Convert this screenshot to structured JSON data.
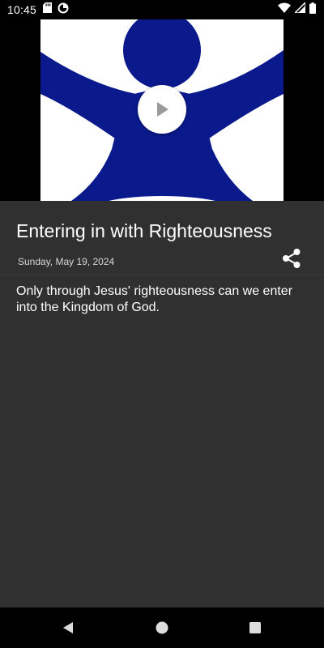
{
  "status_bar": {
    "time": "10:45",
    "left_icons": [
      "sd-card-icon",
      "data-saver-icon"
    ],
    "right_icons": [
      "wifi-icon",
      "signal-icon",
      "battery-icon"
    ]
  },
  "video": {
    "thumbnail_icon": "person-arms-raised-logo",
    "play_icon": "play-icon",
    "brand_color": "#0a1a8c"
  },
  "content": {
    "title": "Entering in with Righteousness",
    "date": "Sunday, May 19, 2024",
    "share_icon": "share-icon",
    "description": "Only through Jesus' righteousness can we enter into the Kingdom of God."
  },
  "nav_bar": {
    "icons": [
      "back-icon",
      "home-icon",
      "recents-icon"
    ]
  },
  "colors": {
    "background": "#303030",
    "text": "#ffffff",
    "secondary_text": "#d8d8d8",
    "system_bars": "#000000"
  }
}
